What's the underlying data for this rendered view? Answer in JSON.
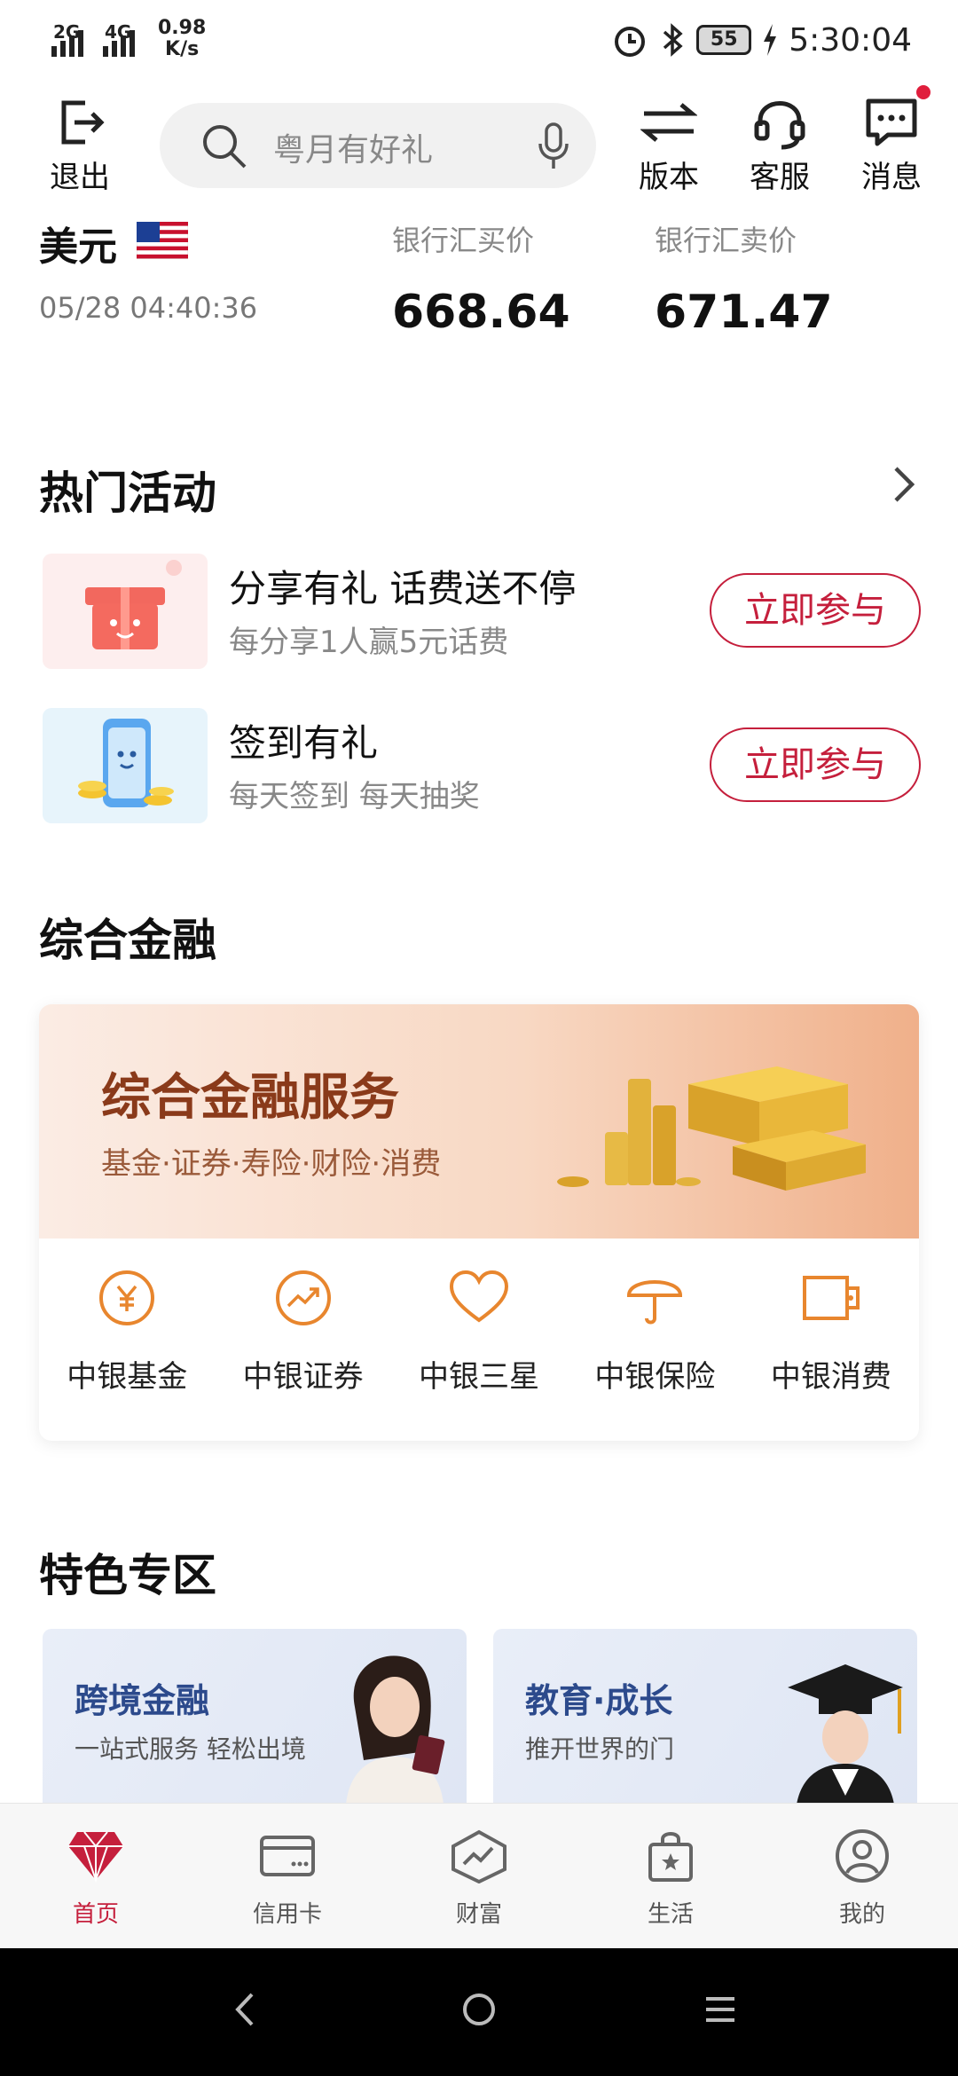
{
  "status_bar": {
    "signal1": "2G",
    "signal2": "4G",
    "net_speed_value": "0.98",
    "net_speed_unit": "K/s",
    "battery": "55",
    "time": "5:30:04"
  },
  "header": {
    "logout_label": "退出",
    "search_placeholder": "粤月有好礼",
    "version_label": "版本",
    "service_label": "客服",
    "message_label": "消息"
  },
  "exchange": {
    "currency": "美元",
    "time": "05/28 04:40:36",
    "buy_label": "银行汇买价",
    "buy_value": "668.64",
    "sell_label": "银行汇卖价",
    "sell_value": "671.47"
  },
  "hot": {
    "title": "热门活动",
    "items": [
      {
        "title": "分享有礼 话费送不停",
        "subtitle": "每分享1人赢5元话费",
        "button": "立即参与"
      },
      {
        "title": "签到有礼",
        "subtitle": "每天签到 每天抽奖",
        "button": "立即参与"
      }
    ]
  },
  "finance": {
    "title": "综合金融",
    "banner_title": "综合金融服务",
    "banner_subtitle": "基金·证券·寿险·财险·消费",
    "items": [
      {
        "label": "中银基金",
        "icon": "yuan-circle-icon"
      },
      {
        "label": "中银证券",
        "icon": "trend-circle-icon"
      },
      {
        "label": "中银三星",
        "icon": "heart-icon"
      },
      {
        "label": "中银保险",
        "icon": "umbrella-icon"
      },
      {
        "label": "中银消费",
        "icon": "wallet-icon"
      }
    ],
    "accent": "#e8862e"
  },
  "featured": {
    "title": "特色专区",
    "cards": [
      {
        "title": "跨境金融",
        "subtitle": "一站式服务 轻松出境"
      },
      {
        "title": "教育·成长",
        "subtitle": "推开世界的门"
      }
    ]
  },
  "bottom_nav": {
    "items": [
      {
        "label": "首页",
        "icon": "diamond-icon",
        "active": true
      },
      {
        "label": "信用卡",
        "icon": "card-icon"
      },
      {
        "label": "财富",
        "icon": "wealth-icon"
      },
      {
        "label": "生活",
        "icon": "bag-icon"
      },
      {
        "label": "我的",
        "icon": "user-icon"
      }
    ]
  },
  "colors": {
    "brand_red": "#c51f3c",
    "finance_orange": "#e8862e"
  }
}
